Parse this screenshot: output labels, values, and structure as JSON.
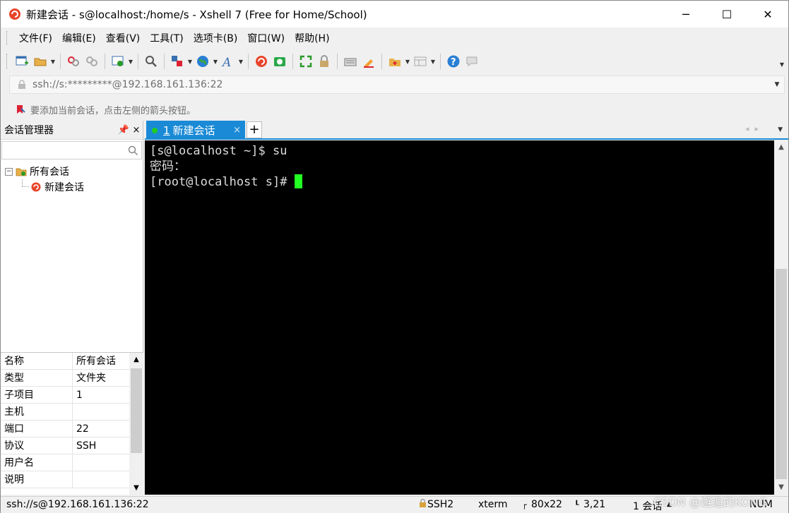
{
  "window": {
    "title": "新建会话 - s@localhost:/home/s - Xshell 7 (Free for Home/School)",
    "controls": {
      "minimize": "─",
      "maximize": "☐",
      "close": "✕"
    }
  },
  "menu": [
    "文件(F)",
    "编辑(E)",
    "查看(V)",
    "工具(T)",
    "选项卡(B)",
    "窗口(W)",
    "帮助(H)"
  ],
  "toolbar": {
    "icons": [
      "new-session-icon",
      "open-folder-icon",
      "reconnect-icon",
      "disconnect-icon",
      "properties-icon",
      "find-icon",
      "transfer-icon",
      "globe-icon",
      "font-icon",
      "xshell-icon",
      "xftp-icon",
      "fullscreen-icon",
      "lock-icon",
      "keyboard-icon",
      "highlight-icon",
      "new-folder-icon",
      "layout-icon",
      "help-icon",
      "chat-icon"
    ]
  },
  "address": {
    "value": "ssh://s:*********@192.168.161.136:22"
  },
  "hint": {
    "text": "要添加当前会话，点击左侧的箭头按钮。"
  },
  "session_manager": {
    "title": "会话管理器",
    "pin": "ꟷ",
    "close": "×",
    "tree": {
      "root": "所有会话",
      "expander": "⊟",
      "children": [
        "新建会话"
      ]
    },
    "properties": [
      {
        "key": "名称",
        "value": "所有会话"
      },
      {
        "key": "类型",
        "value": "文件夹"
      },
      {
        "key": "子项目",
        "value": "1"
      },
      {
        "key": "主机",
        "value": ""
      },
      {
        "key": "端口",
        "value": "22"
      },
      {
        "key": "协议",
        "value": "SSH"
      },
      {
        "key": "用户名",
        "value": ""
      },
      {
        "key": "说明",
        "value": ""
      }
    ]
  },
  "tabs": {
    "active": {
      "number": "1",
      "label": "新建会话",
      "close": "×"
    },
    "add": "+"
  },
  "terminal": {
    "lines": [
      "[s@localhost ~]$ su",
      "密码：",
      "[root@localhost s]# "
    ],
    "cursor_color": "#22ff22"
  },
  "status": {
    "connection": "ssh://s@192.168.161.136:22",
    "protocol": "SSH2",
    "term": "xterm",
    "size": "80x22",
    "cursor_pos": "3,21",
    "sessions": "1 会话",
    "numlock": "NUM"
  },
  "watermark": "CSDN @邂逅的KONG"
}
